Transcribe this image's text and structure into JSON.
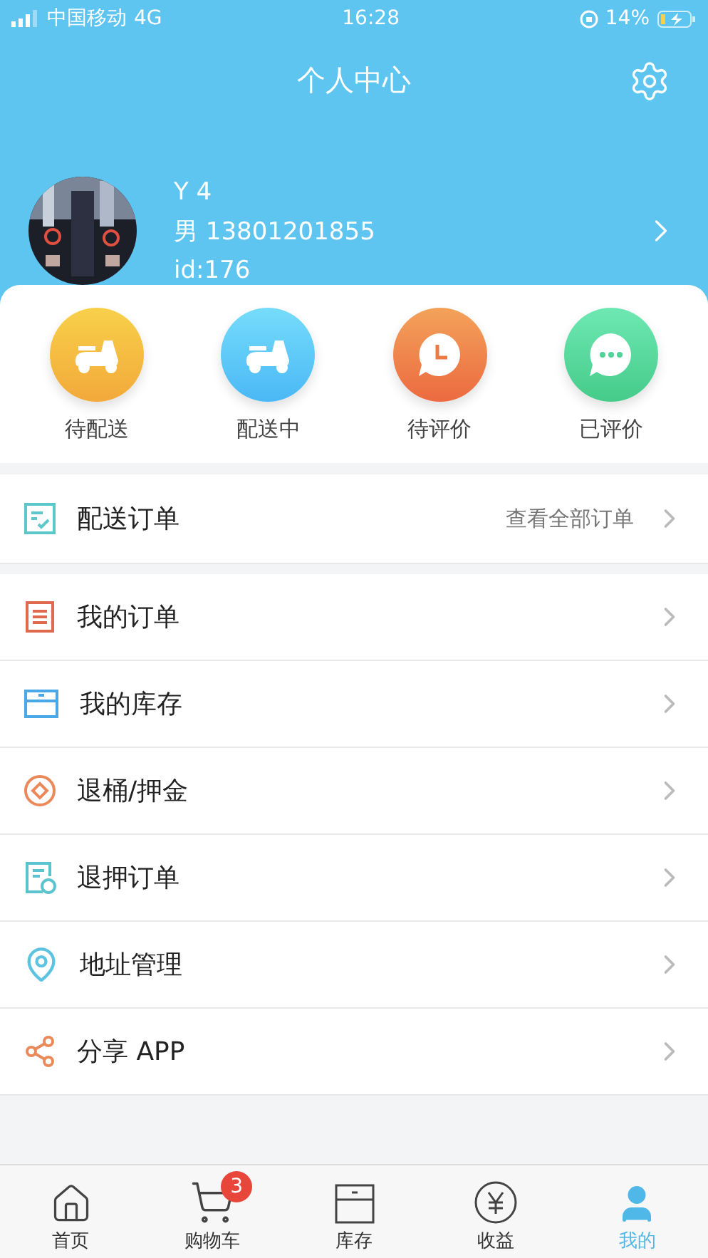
{
  "status_bar": {
    "carrier": "中国移动",
    "network": "4G",
    "time": "16:28",
    "battery": "14%"
  },
  "header": {
    "title": "个人中心"
  },
  "profile": {
    "name": "Y 4",
    "info": "男 13801201855",
    "id": "id:176"
  },
  "order_status": [
    {
      "kind": "pending",
      "label": "待配送"
    },
    {
      "kind": "delivering",
      "label": "配送中"
    },
    {
      "kind": "to_review",
      "label": "待评价"
    },
    {
      "kind": "reviewed",
      "label": "已评价"
    }
  ],
  "delivery_orders": {
    "label": "配送订单",
    "link": "查看全部订单"
  },
  "menu": [
    {
      "kind": "orders",
      "label": "我的订单"
    },
    {
      "kind": "stock",
      "label": "我的库存"
    },
    {
      "kind": "deposit",
      "label": "退桶/押金"
    },
    {
      "kind": "refund",
      "label": "退押订单"
    },
    {
      "kind": "address",
      "label": "地址管理"
    },
    {
      "kind": "share",
      "label": "分享 APP"
    }
  ],
  "tabs": [
    {
      "kind": "home",
      "label": "首页",
      "selected": false
    },
    {
      "kind": "cart",
      "label": "购物车",
      "selected": false,
      "badge": "3"
    },
    {
      "kind": "stock",
      "label": "库存",
      "selected": false
    },
    {
      "kind": "income",
      "label": "收益",
      "selected": false
    },
    {
      "kind": "me",
      "label": "我的",
      "selected": true
    }
  ]
}
